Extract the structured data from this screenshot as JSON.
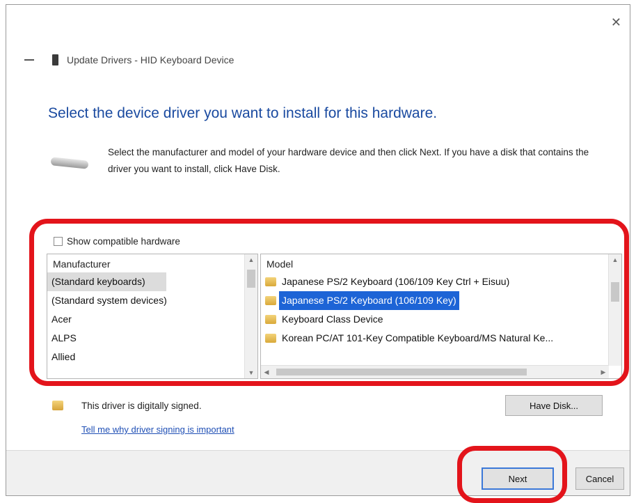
{
  "window": {
    "title": "Update Drivers - HID Keyboard Device",
    "close_glyph": "✕"
  },
  "heading": "Select the device driver you want to install for this hardware.",
  "description": "Select the manufacturer and model of your hardware device and then click Next. If you have a disk that contains the driver you want to install, click Have Disk.",
  "compatible": {
    "label": "Show compatible hardware",
    "checked": false
  },
  "manufacturer_list": {
    "header": "Manufacturer",
    "items": [
      "(Standard keyboards)",
      "(Standard system devices)",
      "Acer",
      "ALPS",
      "Allied"
    ],
    "selected_index": 0
  },
  "model_list": {
    "header": "Model",
    "items": [
      "Japanese PS/2 Keyboard (106/109 Key Ctrl + Eisuu)",
      "Japanese PS/2 Keyboard (106/109 Key)",
      "Keyboard Class Device",
      "Korean PC/AT 101-Key Compatible Keyboard/MS Natural Ke..."
    ],
    "selected_index": 1
  },
  "signing": {
    "status": "This driver is digitally signed.",
    "link": "Tell me why driver signing is important"
  },
  "buttons": {
    "have_disk": "Have Disk...",
    "next": "Next",
    "cancel": "Cancel"
  },
  "colors": {
    "accent_blue": "#1d64d6",
    "heading_blue": "#1a4aa0",
    "highlight_red": "#e3141b"
  }
}
